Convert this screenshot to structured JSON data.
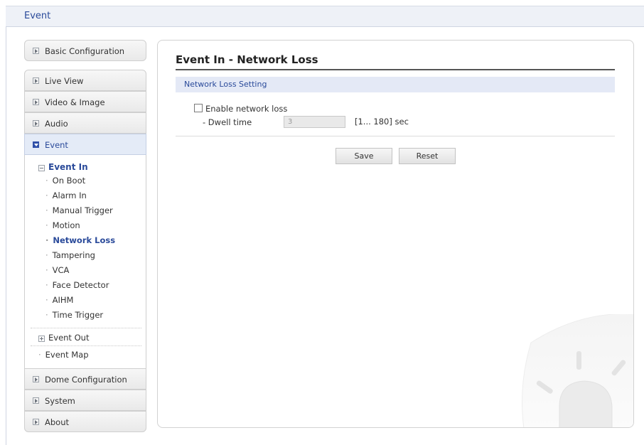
{
  "header": {
    "title": "Event"
  },
  "sidebar": {
    "basic_config": "Basic Configuration",
    "live_view": "Live View",
    "video_image": "Video & Image",
    "audio": "Audio",
    "event": "Event",
    "event_in": "Event In",
    "event_in_items": [
      "On Boot",
      "Alarm In",
      "Manual Trigger",
      "Motion",
      "Network Loss",
      "Tampering",
      "VCA",
      "Face Detector",
      "AIHM",
      "Time Trigger"
    ],
    "event_out": "Event Out",
    "event_map": "Event Map",
    "dome_config": "Dome Configuration",
    "system": "System",
    "about": "About",
    "bullet": "·"
  },
  "main": {
    "title": "Event In - Network Loss",
    "section": "Network Loss Setting",
    "enable_label": "Enable network loss",
    "enable_checked": false,
    "dwell_label": "- Dwell time",
    "dwell_value": "3",
    "dwell_range": "[1... 180] sec",
    "save": "Save",
    "reset": "Reset"
  },
  "colors": {
    "accent": "#2a4a9a",
    "section_bg": "#e4e9f6",
    "active_nav_bg": "#e4ebf7"
  },
  "icons": {
    "nav_expander": "expand-arrow-icon",
    "tree_collapse": "minus-box-icon",
    "tree_expand": "plus-box-icon",
    "watermark": "alarm-beacon-icon"
  }
}
